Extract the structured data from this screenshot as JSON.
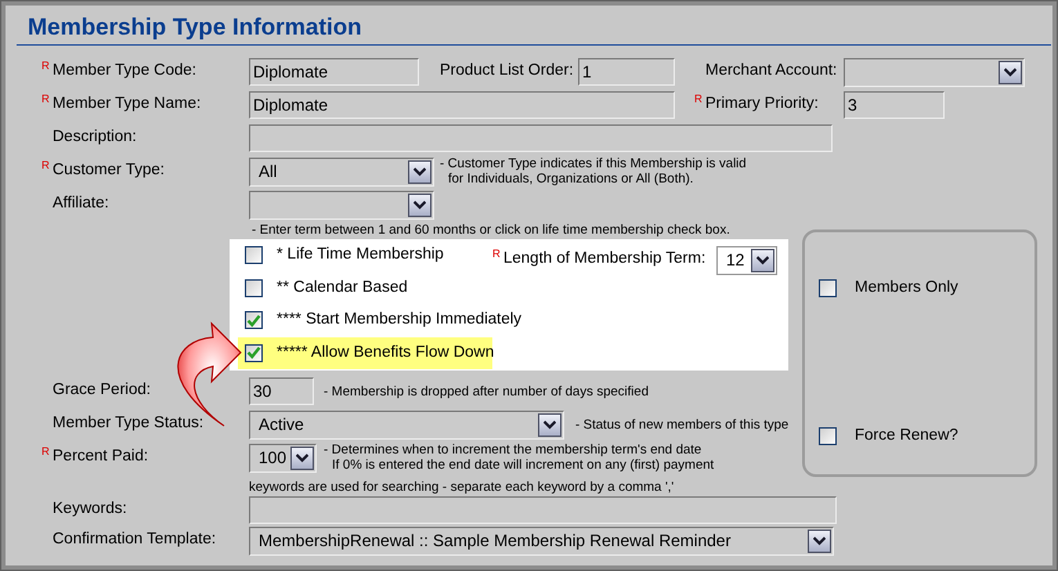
{
  "title": "Membership Type Information",
  "member_type_code": {
    "required_mark": "R",
    "label": "Member Type Code:",
    "value": "Diplomate"
  },
  "product_list_order": {
    "label": "Product List Order:",
    "value": "1"
  },
  "merchant_account": {
    "label": "Merchant Account:"
  },
  "member_type_name": {
    "required_mark": "R",
    "label": "Member Type Name:",
    "value": "Diplomate"
  },
  "primary_priority": {
    "required_mark": "R",
    "label": "Primary Priority:",
    "value": "3"
  },
  "description": {
    "label": "Description:"
  },
  "customer_type": {
    "required_mark": "R",
    "label": "Customer Type:",
    "value": "All",
    "note": [
      "- Customer Type indicates if this Membership is valid",
      "for Individuals, Organizations or All (Both)."
    ]
  },
  "affiliate": {
    "label": "Affiliate:"
  },
  "term_note": "- Enter term between 1 and 60 months or click on life time membership check box.",
  "term_options": [
    {
      "label": "* Life Time Membership",
      "checked": false,
      "highlighted": false
    },
    {
      "label": "** Calendar Based",
      "checked": false,
      "highlighted": false
    },
    {
      "label": "**** Start Membership Immediately",
      "checked": true,
      "highlighted": false
    },
    {
      "label": "***** Allow Benefits Flow Down",
      "checked": true,
      "highlighted": true
    }
  ],
  "length_of_term": {
    "required_mark": "R",
    "label": "Length of Membership Term:",
    "value": "12"
  },
  "side_options": [
    {
      "label": "Members Only",
      "checked": false
    },
    {
      "label": "Force Renew?",
      "checked": false
    }
  ],
  "grace_period": {
    "label": "Grace Period:",
    "value": "30",
    "note": [
      "- Membership is dropped after number of days specified"
    ]
  },
  "member_type_status": {
    "label": "Member Type Status:",
    "value": "Active",
    "note": [
      "- Status of new members of this type"
    ]
  },
  "percent_paid": {
    "required_mark": "R",
    "label": "Percent Paid:",
    "value": "100",
    "note": [
      "- Determines when to increment the membership term's end date",
      "If 0% is entered the end date will increment on any (first) payment"
    ]
  },
  "keywords": {
    "label": "Keywords:",
    "hint": "keywords are used for searching - separate each keyword by a comma ','"
  },
  "confirmation_template": {
    "label": "Confirmation Template:",
    "value": "MembershipRenewal :: Sample Membership Renewal Reminder"
  }
}
